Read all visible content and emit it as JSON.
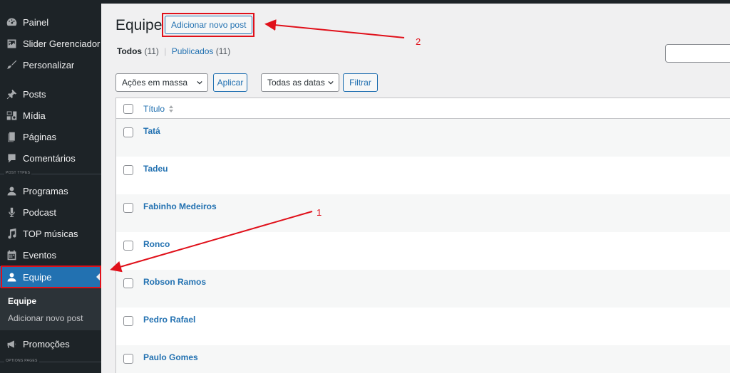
{
  "sidebar": {
    "items": [
      {
        "label": "Painel",
        "icon": "dashboard-icon"
      },
      {
        "label": "Slider Gerenciador",
        "icon": "image-icon"
      },
      {
        "label": "Personalizar",
        "icon": "brush-icon"
      },
      {
        "label": "Posts",
        "icon": "pin-icon"
      },
      {
        "label": "Mídia",
        "icon": "media-icon"
      },
      {
        "label": "Páginas",
        "icon": "page-icon"
      },
      {
        "label": "Comentários",
        "icon": "comment-icon"
      },
      {
        "label": "Programas",
        "icon": "user-icon"
      },
      {
        "label": "Podcast",
        "icon": "microphone-icon"
      },
      {
        "label": "TOP músicas",
        "icon": "music-icon"
      },
      {
        "label": "Eventos",
        "icon": "calendar-icon"
      },
      {
        "label": "Equipe",
        "icon": "user-icon"
      },
      {
        "label": "Promoções",
        "icon": "megaphone-icon"
      }
    ],
    "separator_post_types": "POST TYPES",
    "separator_options_pages": "OPTIONS PAGES",
    "submenu": {
      "current": "Equipe",
      "add_new": "Adicionar novo post"
    }
  },
  "main": {
    "title": "Equipe",
    "add_new_button": "Adicionar novo post",
    "views": {
      "all_label": "Todos",
      "all_count": "(11)",
      "separator": "|",
      "published_label": "Publicados",
      "published_count": "(11)"
    },
    "bulk_actions": "Ações em massa",
    "apply_button": "Aplicar",
    "dates_filter": "Todas as datas",
    "filter_button": "Filtrar",
    "table": {
      "column_title": "Título",
      "rows": [
        "Tatá",
        "Tadeu",
        "Fabinho Medeiros",
        "Ronco",
        "Robson Ramos",
        "Pedro Rafael",
        "Paulo Gomes"
      ]
    }
  },
  "annotations": {
    "marker_1": "1",
    "marker_2": "2",
    "color": "#e0101a"
  },
  "colors": {
    "sidebar_bg": "#1d2327",
    "accent": "#2271b1",
    "content_bg": "#f0f0f1"
  }
}
